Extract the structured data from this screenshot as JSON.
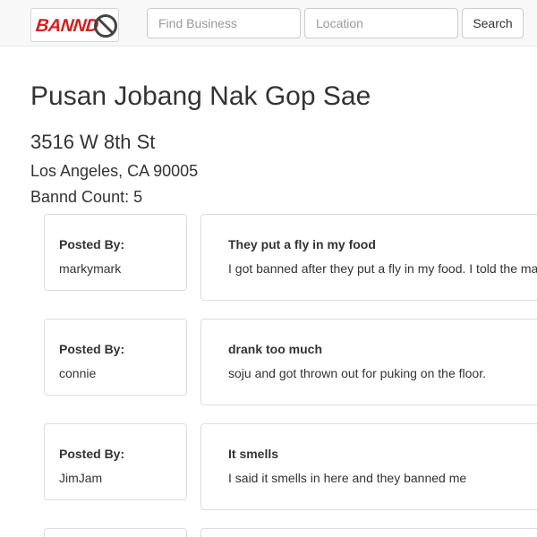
{
  "navbar": {
    "logo_text": "BANND",
    "business_placeholder": "Find Business",
    "location_placeholder": "Location",
    "search_label": "Search",
    "accent_color": "#d0201f"
  },
  "business": {
    "name": "Pusan Jobang Nak Gop Sae",
    "street": "3516 W 8th St",
    "city_state_zip": "Los Angeles, CA 90005",
    "bannd_count": "Bannd Count: 5"
  },
  "posts": [
    {
      "posted_by_label": "Posted By:",
      "author": "markymark",
      "title": "They put a fly in my food",
      "body": "I got banned after they put a fly in my food. I told the manager"
    },
    {
      "posted_by_label": "Posted By:",
      "author": "connie",
      "title": "drank too much",
      "body": "soju and got thrown out for puking on the floor."
    },
    {
      "posted_by_label": "Posted By:",
      "author": "JimJam",
      "title": "It smells",
      "body": "I said it smells in here and they banned me"
    }
  ]
}
